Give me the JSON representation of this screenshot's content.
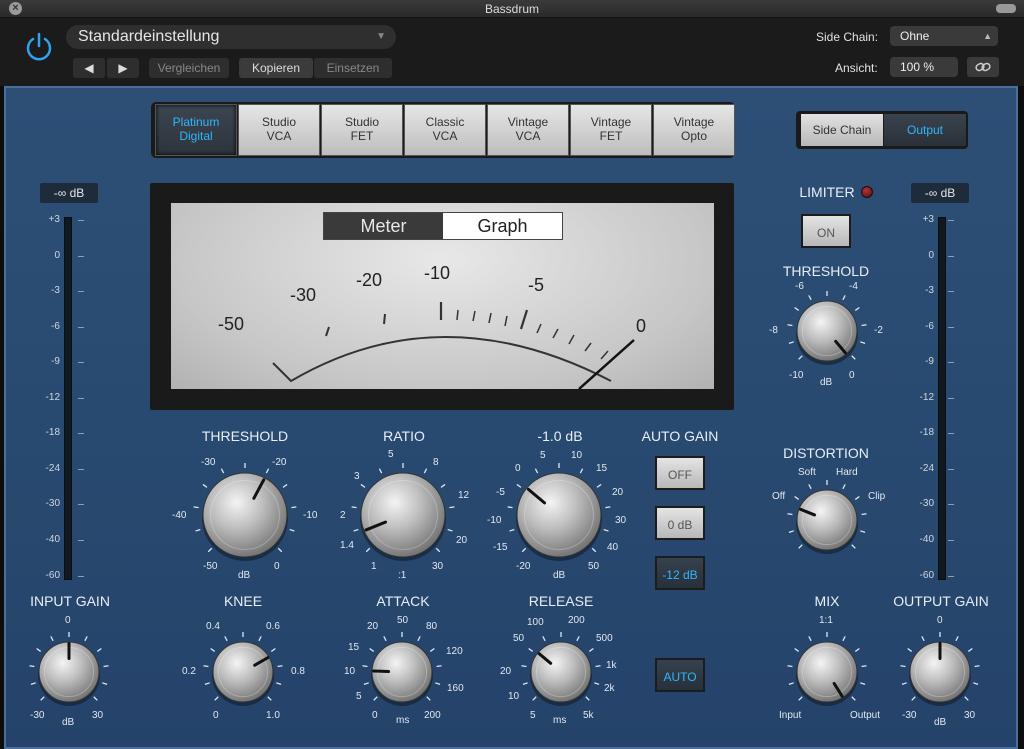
{
  "window": {
    "title": "Bassdrum"
  },
  "header": {
    "preset": "Standardeinstellung",
    "compare": "Vergleichen",
    "copy": "Kopieren",
    "paste": "Einsetzen",
    "side_chain_label": "Side Chain:",
    "side_chain_value": "Ohne",
    "view_label": "Ansicht:",
    "view_value": "100 %"
  },
  "models": [
    {
      "label": "Platinum\nDigital",
      "active": true
    },
    {
      "label": "Studio\nVCA",
      "active": false
    },
    {
      "label": "Studio\nFET",
      "active": false
    },
    {
      "label": "Classic\nVCA",
      "active": false
    },
    {
      "label": "Vintage\nVCA",
      "active": false
    },
    {
      "label": "Vintage\nFET",
      "active": false
    },
    {
      "label": "Vintage\nOpto",
      "active": false
    }
  ],
  "side_switch": {
    "side_chain": "Side Chain",
    "output": "Output"
  },
  "meter": {
    "toggle": {
      "meter": "Meter",
      "graph": "Graph"
    },
    "scale": [
      "-50",
      "-30",
      "-20",
      "-10",
      "-5",
      "0"
    ]
  },
  "input": {
    "readout": "-∞ dB",
    "label": "INPUT GAIN",
    "ticks": {
      "top": "0",
      "left": "-30",
      "unit": "dB",
      "right": "30"
    }
  },
  "output": {
    "readout": "-∞ dB",
    "label": "OUTPUT GAIN",
    "ticks": {
      "top": "0",
      "left": "-30",
      "unit": "dB",
      "right": "30"
    }
  },
  "level_scale": [
    "+3",
    "0",
    "-3",
    "-6",
    "-9",
    "-12",
    "-18",
    "-24",
    "-30",
    "-40",
    "-60"
  ],
  "threshold": {
    "label": "THRESHOLD",
    "ticks": [
      "-50",
      "-40",
      "-30",
      "-20",
      "-10",
      "0"
    ],
    "unit": "dB"
  },
  "ratio": {
    "label": "RATIO",
    "ticks": [
      "1",
      "1.4",
      "2",
      "3",
      "5",
      "8",
      "12",
      "20",
      "30"
    ],
    "unit": ":1"
  },
  "makeup": {
    "label": "-1.0 dB",
    "ticks": [
      "-20",
      "-15",
      "-10",
      "-5",
      "0",
      "5",
      "10",
      "15",
      "20",
      "30",
      "40",
      "50"
    ],
    "unit": "dB"
  },
  "auto_gain": {
    "label": "AUTO GAIN",
    "off": "OFF",
    "zero": "0 dB",
    "minus12": "-12 dB"
  },
  "knee": {
    "label": "KNEE",
    "ticks": [
      "0",
      "0.2",
      "0.4",
      "0.6",
      "0.8",
      "1.0"
    ]
  },
  "attack": {
    "label": "ATTACK",
    "ticks": [
      "0",
      "5",
      "10",
      "15",
      "20",
      "50",
      "80",
      "120",
      "160",
      "200"
    ],
    "unit": "ms"
  },
  "release": {
    "label": "RELEASE",
    "ticks": [
      "5",
      "10",
      "20",
      "50",
      "100",
      "200",
      "500",
      "1k",
      "2k",
      "5k"
    ],
    "unit": "ms"
  },
  "release_auto": "AUTO",
  "limiter": {
    "label": "LIMITER",
    "on": "ON",
    "threshold_label": "THRESHOLD",
    "ticks": [
      "-10",
      "-8",
      "-6",
      "-4",
      "-2",
      "0"
    ],
    "unit": "dB"
  },
  "distortion": {
    "label": "DISTORTION",
    "off": "Off",
    "soft": "Soft",
    "hard": "Hard",
    "clip": "Clip"
  },
  "mix": {
    "label": "MIX",
    "top": "1:1",
    "left": "Input",
    "right": "Output"
  }
}
